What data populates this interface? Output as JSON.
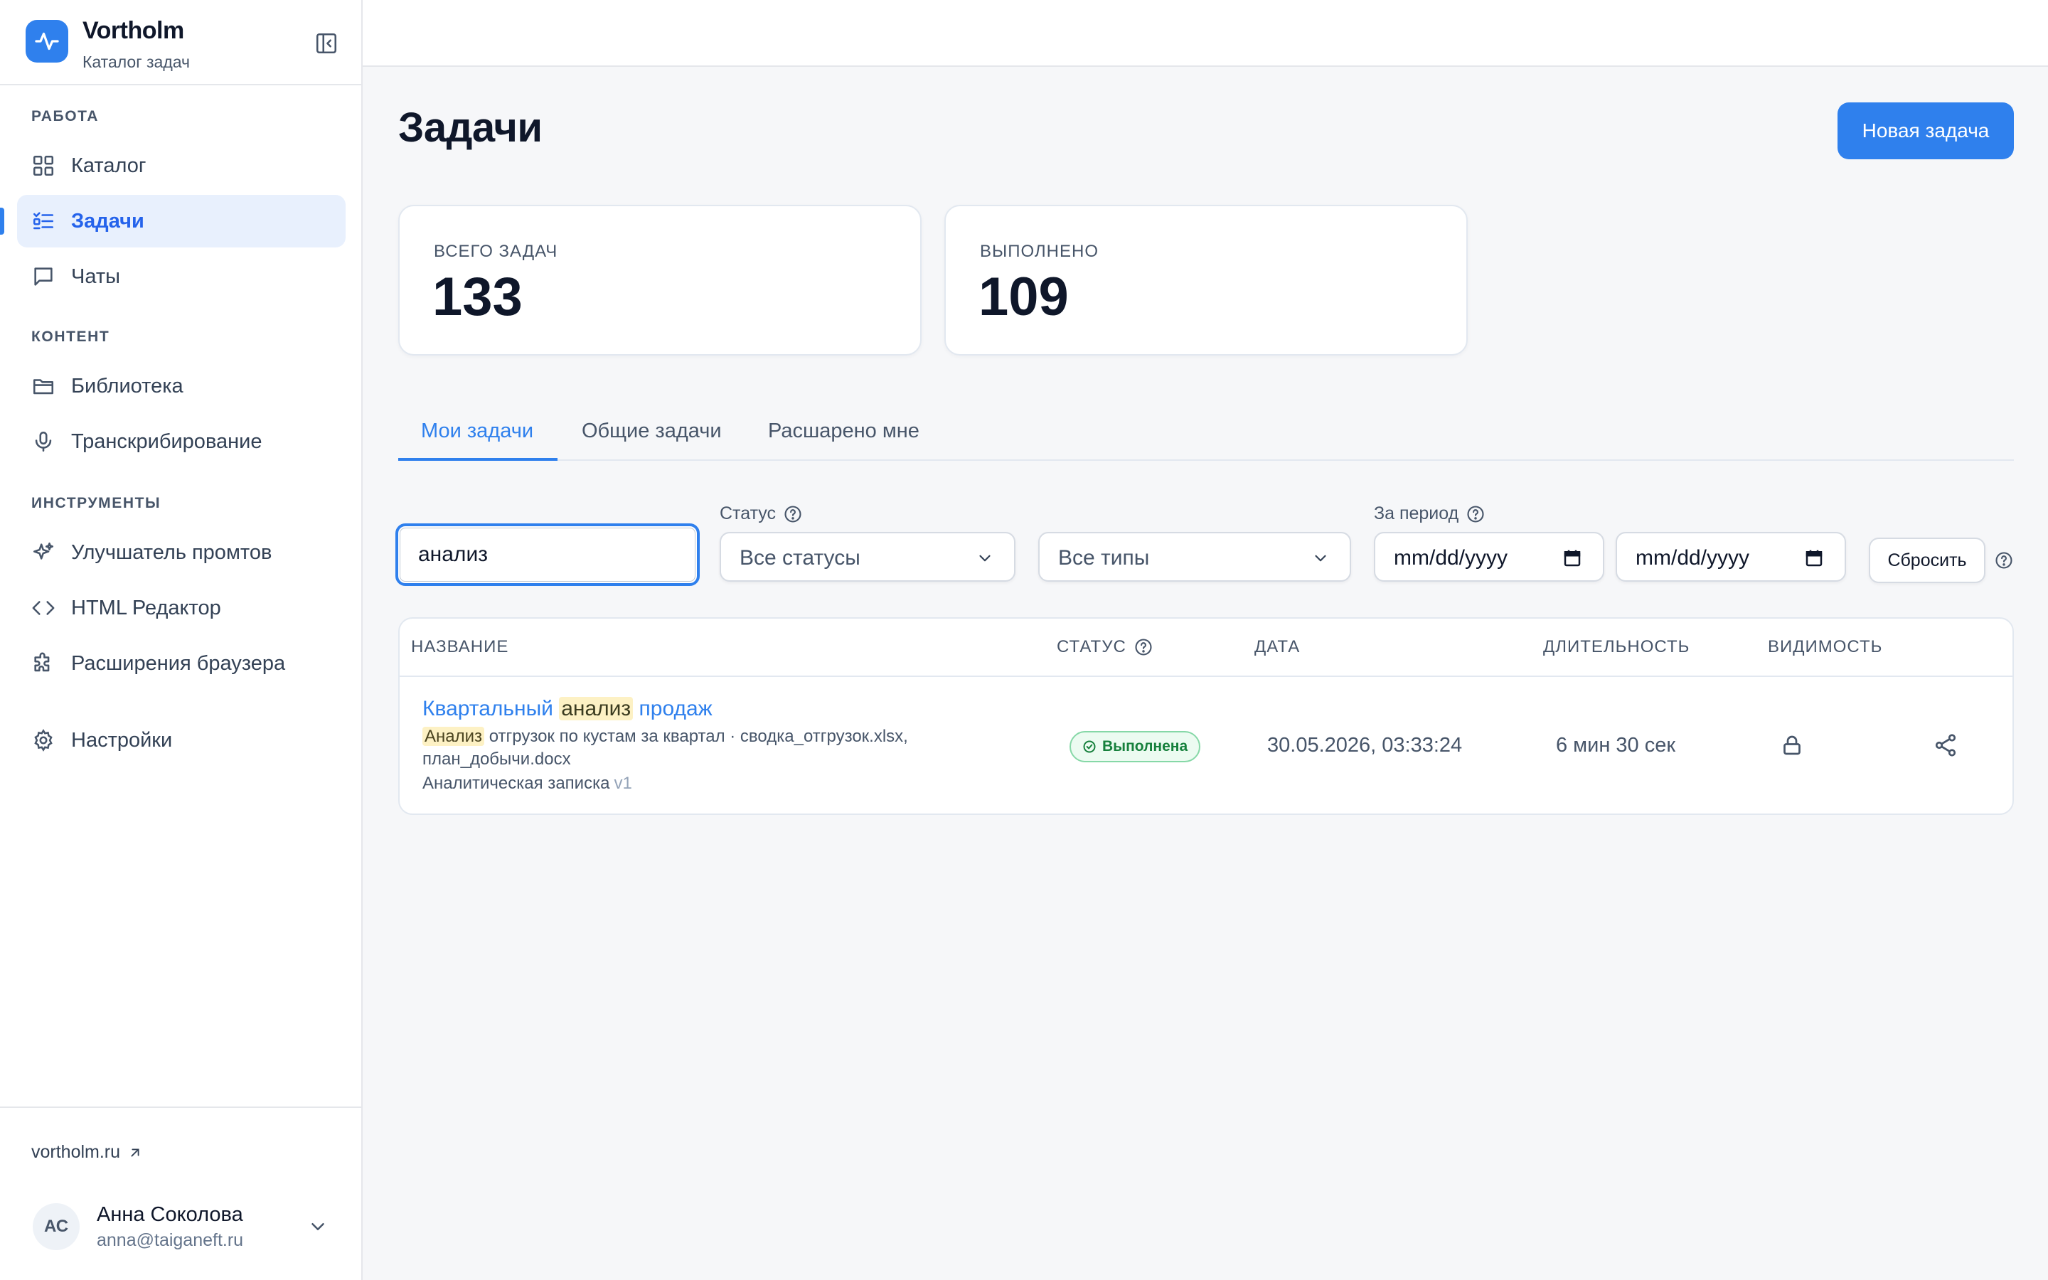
{
  "app": {
    "name": "Vortholm",
    "subtitle": "Каталог задач",
    "accent_color": "#2f80ed"
  },
  "sidebar": {
    "sections": [
      {
        "title": "РАБОТА",
        "items": [
          {
            "label": "Каталог",
            "icon": "grid-icon"
          },
          {
            "label": "Задачи",
            "icon": "list-check-icon",
            "active": true
          },
          {
            "label": "Чаты",
            "icon": "chat-icon"
          }
        ]
      },
      {
        "title": "КОНТЕНТ",
        "items": [
          {
            "label": "Библиотека",
            "icon": "folder-icon"
          },
          {
            "label": "Транскрибирование",
            "icon": "microphone-icon"
          }
        ]
      },
      {
        "title": "ИНСТРУМЕНТЫ",
        "items": [
          {
            "label": "Улучшатель промтов",
            "icon": "sparkles-icon"
          },
          {
            "label": "HTML Редактор",
            "icon": "code-icon"
          },
          {
            "label": "Расширения браузера",
            "icon": "puzzle-icon"
          }
        ]
      }
    ],
    "settings": {
      "label": "Настройки",
      "icon": "gear-icon"
    },
    "footer": {
      "link": "vortholm.ru",
      "user": {
        "initials": "АС",
        "name": "Анна Соколова",
        "email": "anna@taiganeft.ru"
      }
    }
  },
  "page": {
    "title": "Задачи",
    "new_task_button": "Новая задача"
  },
  "stats": [
    {
      "label": "ВСЕГО ЗАДАЧ",
      "value": "133"
    },
    {
      "label": "ВЫПОЛНЕНО",
      "value": "109"
    }
  ],
  "tabs": [
    {
      "label": "Мои задачи",
      "active": true
    },
    {
      "label": "Общие задачи"
    },
    {
      "label": "Расшарено мне"
    }
  ],
  "filters": {
    "search_value": "анализ",
    "status_label": "Статус",
    "status_value": "Все статусы",
    "type_value": "Все типы",
    "period_label": "За период",
    "date_from_placeholder": "mm/dd/yyyy",
    "date_to_placeholder": "mm/dd/yyyy",
    "reset_button": "Сбросить"
  },
  "table": {
    "columns": [
      "НАЗВАНИЕ",
      "СТАТУС",
      "ДАТА",
      "ДЛИТЕЛЬНОСТЬ",
      "ВИДИМОСТЬ"
    ],
    "rows": [
      {
        "title_before": "Квартальный ",
        "title_highlight": "анализ",
        "title_after": " продаж",
        "desc_highlight": "Анализ",
        "desc_rest": " отгрузок по кустам за квартал · сводка_отгрузок.xlsx, план_добычи.docx",
        "type": "Аналитическая записка",
        "version": "v1",
        "status": "Выполнена",
        "status_color": "#16803c",
        "date": "30.05.2026, 03:33:24",
        "duration": "6 мин 30 сек",
        "visibility_icon": "lock-icon",
        "action_icon": "share-icon"
      }
    ]
  }
}
